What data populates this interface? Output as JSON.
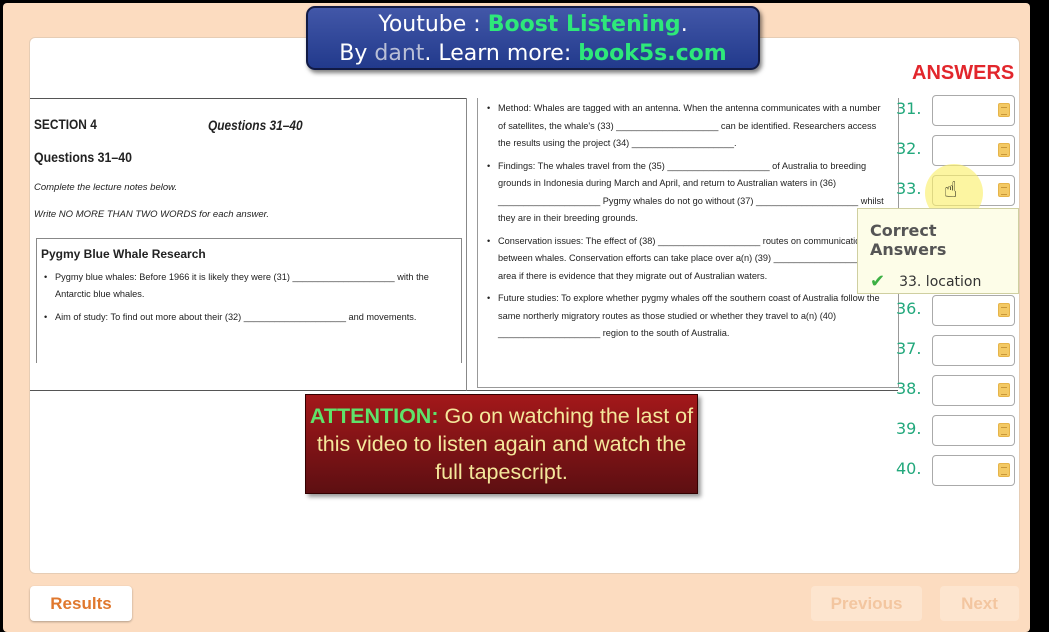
{
  "banner": {
    "line1_prefix": "Youtube : ",
    "line1_channel": "Boost Listening",
    "line1_suffix": ".",
    "line2_by": "By ",
    "line2_author": "dant",
    "line2_mid": ". Learn more: ",
    "line2_site": "book5s.com"
  },
  "worksheet": {
    "section": "SECTION 4",
    "questions_header": "Questions 31–40",
    "questions_title": "Questions 31–40",
    "instruction1": "Complete the lecture notes below.",
    "instruction2": "Write NO MORE THAN TWO WORDS for each answer.",
    "box_title": "Pygmy Blue Whale Research",
    "bullets_left": [
      "Pygmy blue whales: Before 1966 it is likely they were (31) ____________________ with the Antarctic blue whales.",
      "Aim of study: To find out more about their (32) ____________________ and movements."
    ],
    "bullets_right": [
      "Method: Whales are tagged with an antenna. When the antenna communicates with a number of satellites, the whale's (33) ____________________ can be identified. Researchers access the results using the project (34) ____________________.",
      "Findings: The whales travel from the (35) ____________________ of Australia to breeding grounds in Indonesia during March and April, and return to Australian waters in (36) ____________________ Pygmy whales do not go without (37) ____________________ whilst they are in their breeding grounds.",
      "Conservation issues: The effect of (38) ____________________ routes on communication between whales. Conservation efforts can take place over a(n) (39) ____________________ area if there is evidence that they migrate out of Australian waters.",
      "Future studies: To explore whether pygmy whales off the southern coast of Australia follow the same northerly migratory routes as those studied or whether they travel to a(n) (40) ____________________ region to the south of Australia."
    ]
  },
  "answers": {
    "title": "ANSWERS",
    "rows": [
      {
        "num": "31.",
        "value": ""
      },
      {
        "num": "32.",
        "value": ""
      },
      {
        "num": "33.",
        "value": ""
      },
      {
        "num": "36.",
        "value": ""
      },
      {
        "num": "37.",
        "value": ""
      },
      {
        "num": "38.",
        "value": ""
      },
      {
        "num": "39.",
        "value": ""
      },
      {
        "num": "40.",
        "value": ""
      }
    ]
  },
  "popup": {
    "title": "Correct Answers",
    "answer": "33. location",
    "icon": "check-icon"
  },
  "attention": {
    "label": "ATTENTION:",
    "text": " Go on watching the last of this video to listen again and watch the full tapescript."
  },
  "buttons": {
    "results": "Results",
    "previous": "Previous",
    "next": "Next"
  },
  "colors": {
    "answers_title": "#e2262c",
    "numbers": "#22a87c",
    "results": "#e0782e",
    "attention_bg": "#8b1517"
  }
}
